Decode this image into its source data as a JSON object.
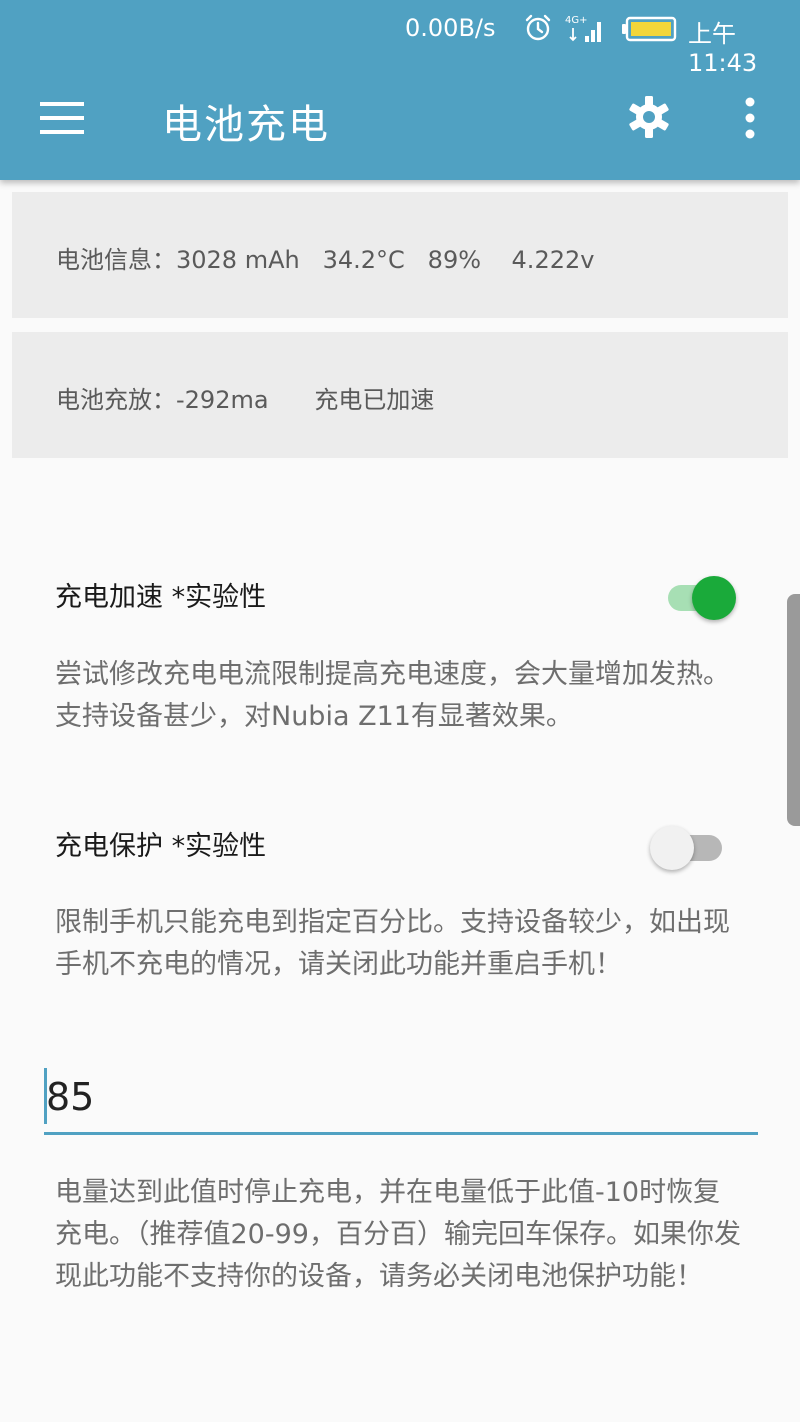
{
  "status_bar": {
    "speed": "0.00B/s",
    "time": "上午11:43",
    "network": "4G+",
    "icons": [
      "alarm-icon",
      "signal-icon",
      "battery-icon"
    ]
  },
  "app_bar": {
    "title": "电池充电",
    "icons": [
      "menu-icon",
      "gear-icon",
      "more-vert-icon"
    ]
  },
  "cards": {
    "battery_info": "电池信息：3028 mAh   34.2°C   89%    4.222v",
    "battery_charge": "电池充放：-292ma      充电已加速"
  },
  "prefs": {
    "boost": {
      "title": "充电加速 *实验性",
      "desc": "尝试修改充电电流限制提高充电速度，会大量增加发热。支持设备甚少，对Nubia Z11有显著效果。",
      "enabled": true
    },
    "protect": {
      "title": "充电保护 *实验性",
      "desc": "限制手机只能充电到指定百分比。支持设备较少，如出现手机不充电的情况，请关闭此功能并重启手机！",
      "enabled": false
    }
  },
  "threshold": {
    "value": "85",
    "desc": "电量达到此值时停止充电，并在电量低于此值-10时恢复充电。（推荐值20-99，百分百）输完回车保存。如果你发现此功能不支持你的设备，请务必关闭电池保护功能！"
  },
  "colors": {
    "primary": "#50a1c2",
    "switch_on": "#1aaa3a",
    "card_bg": "#ececec"
  }
}
